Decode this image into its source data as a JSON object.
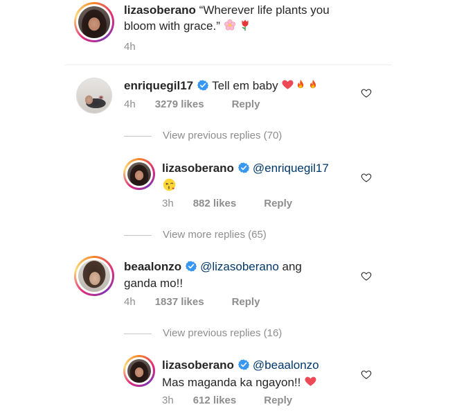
{
  "caption": {
    "username": "lizasoberano",
    "text_line1": "“Wherever life plants you",
    "text_line2": "bloom with grace.”",
    "emoji_names": [
      "cherry-blossom",
      "tulip"
    ],
    "time": "4h"
  },
  "comments": [
    {
      "username": "enriquegil17",
      "verified": true,
      "text": "Tell em baby",
      "emoji_names": [
        "red-heart",
        "fire",
        "fire"
      ],
      "time": "4h",
      "likes": "3279 likes",
      "reply": "Reply",
      "view_replies": "View previous replies (70)",
      "replies": [
        {
          "username": "lizasoberano",
          "verified": true,
          "mention": "@enriquegil17",
          "emoji_names": [
            "face-blowing-a-kiss"
          ],
          "time": "3h",
          "likes": "882 likes",
          "reply": "Reply"
        }
      ],
      "view_more": "View more replies (65)"
    },
    {
      "username": "beaalonzo",
      "verified": true,
      "mention": "@lizasoberano",
      "text_after_mention": "ang",
      "text_line2": "ganda mo!!",
      "time": "4h",
      "likes": "1837 likes",
      "reply": "Reply",
      "view_replies": "View previous replies (16)",
      "replies": [
        {
          "username": "lizasoberano",
          "verified": true,
          "mention": "@beaalonzo",
          "text_line2": "Mas maganda ka ngayon!!",
          "emoji_names": [
            "red-heart"
          ],
          "time": "3h",
          "likes": "612 likes",
          "reply": "Reply"
        }
      ]
    }
  ],
  "colors": {
    "mention": "#00376b",
    "verified": "#3897f0",
    "meta_text": "#8e8e8e",
    "heart_emoji": "#ed4956"
  }
}
